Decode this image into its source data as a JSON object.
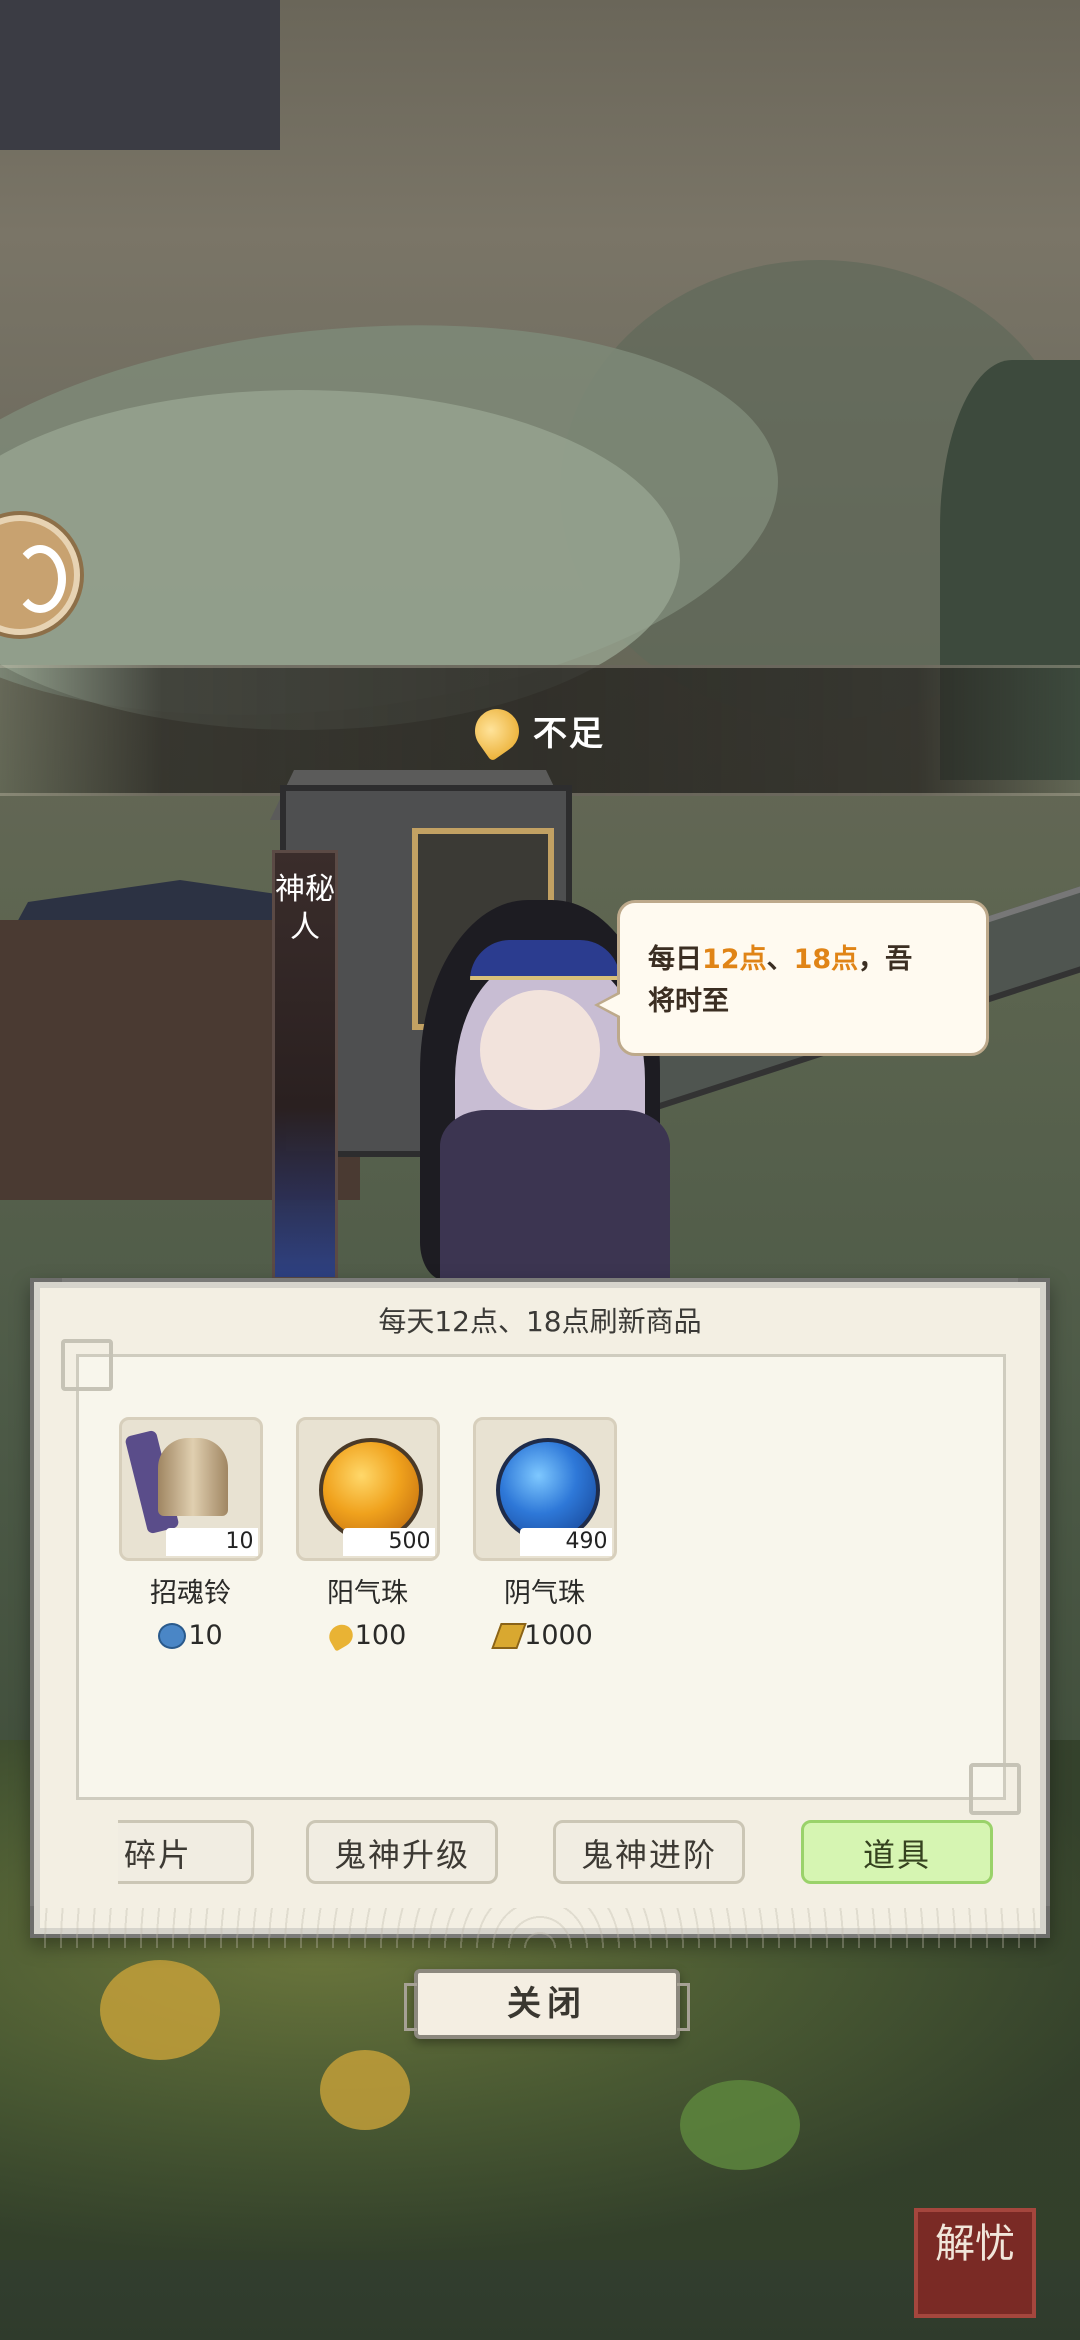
{
  "banner": {
    "text": "不足",
    "icon": "yang-flame-icon"
  },
  "npc": {
    "name": "神秘人",
    "speech": {
      "prefix": "每日",
      "time1": "12点",
      "sep": "、",
      "time2": "18点",
      "suffix1": "，吾",
      "line2": "将时至"
    }
  },
  "shop": {
    "title": "每天12点、18点刷新商品",
    "items": [
      {
        "name": "招魂铃",
        "quantity": "10",
        "price": "10",
        "currency_icon": "blue-coin-icon"
      },
      {
        "name": "阳气珠",
        "quantity": "500",
        "price": "100",
        "currency_icon": "yang-flame-icon"
      },
      {
        "name": "阴气珠",
        "quantity": "490",
        "price": "1000",
        "currency_icon": "talisman-icon"
      }
    ],
    "tabs": [
      {
        "label": "碎片",
        "active": false
      },
      {
        "label": "鬼神升级",
        "active": false
      },
      {
        "label": "鬼神进阶",
        "active": false
      },
      {
        "label": "道具",
        "active": true
      }
    ],
    "close_label": "关闭"
  },
  "seal_text": "解忧",
  "colors": {
    "highlight": "#e08416",
    "active_tab": "#d6f5b2",
    "seal": "#7a2a25"
  }
}
